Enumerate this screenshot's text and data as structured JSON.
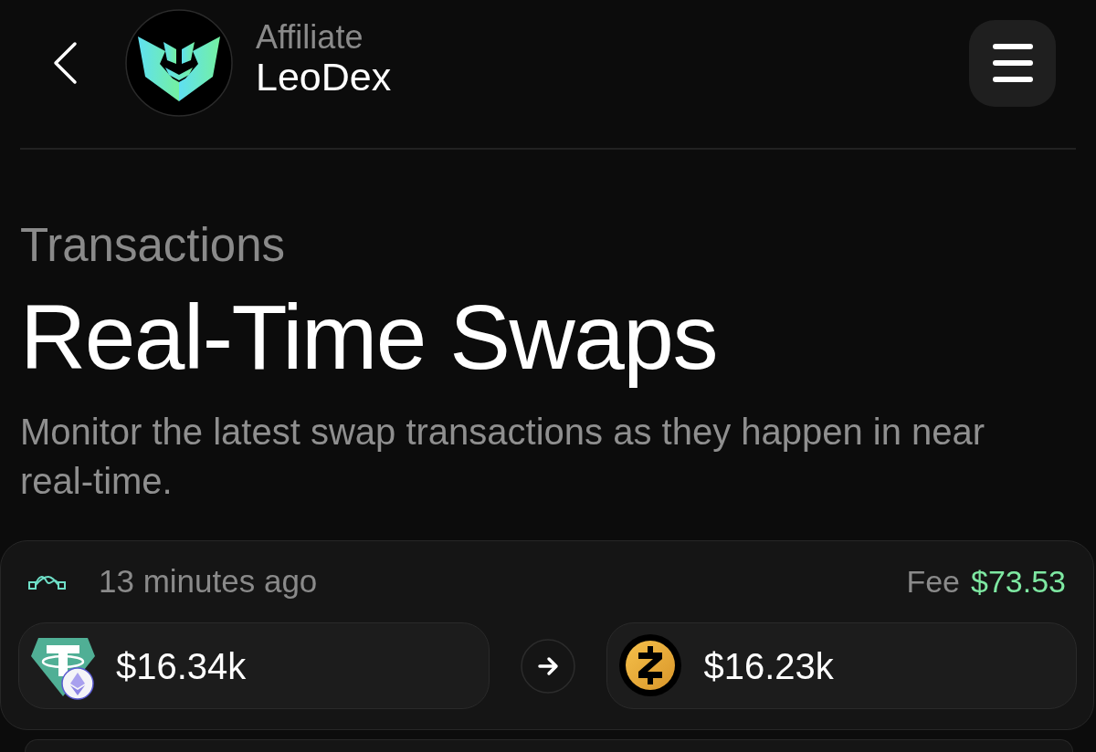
{
  "header": {
    "subtitle": "Affiliate",
    "title": "LeoDex"
  },
  "intro": {
    "eyebrow": "Transactions",
    "title": "Real-Time Swaps",
    "description": "Monitor the latest swap transactions as they happen in near real-time."
  },
  "swaps": [
    {
      "time": "13 minutes ago",
      "fee_label": "Fee",
      "fee": "$73.53",
      "from_amount": "$16.34k",
      "to_amount": "$16.23k"
    }
  ]
}
